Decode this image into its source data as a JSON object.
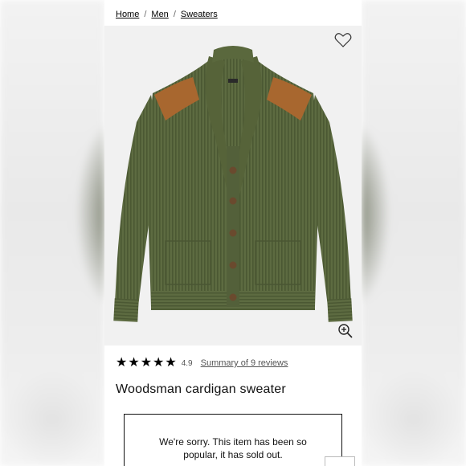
{
  "breadcrumb": {
    "items": [
      "Home",
      "Men",
      "Sweaters"
    ],
    "separator": "/"
  },
  "product": {
    "image_alt_icon": "sweater-image",
    "favorite_icon": "heart-icon",
    "zoom_icon": "zoom-in-icon",
    "rating_value": "4.9",
    "star_count": 5,
    "reviews_link": "Summary of 9 reviews",
    "title": "Woodsman cardigan sweater"
  },
  "notice": {
    "message": "We're sorry. This item has been so popular, it has sold out."
  },
  "colors": {
    "sweater": "#5b6a3f",
    "patch": "#a8672f",
    "text": "#111111"
  }
}
